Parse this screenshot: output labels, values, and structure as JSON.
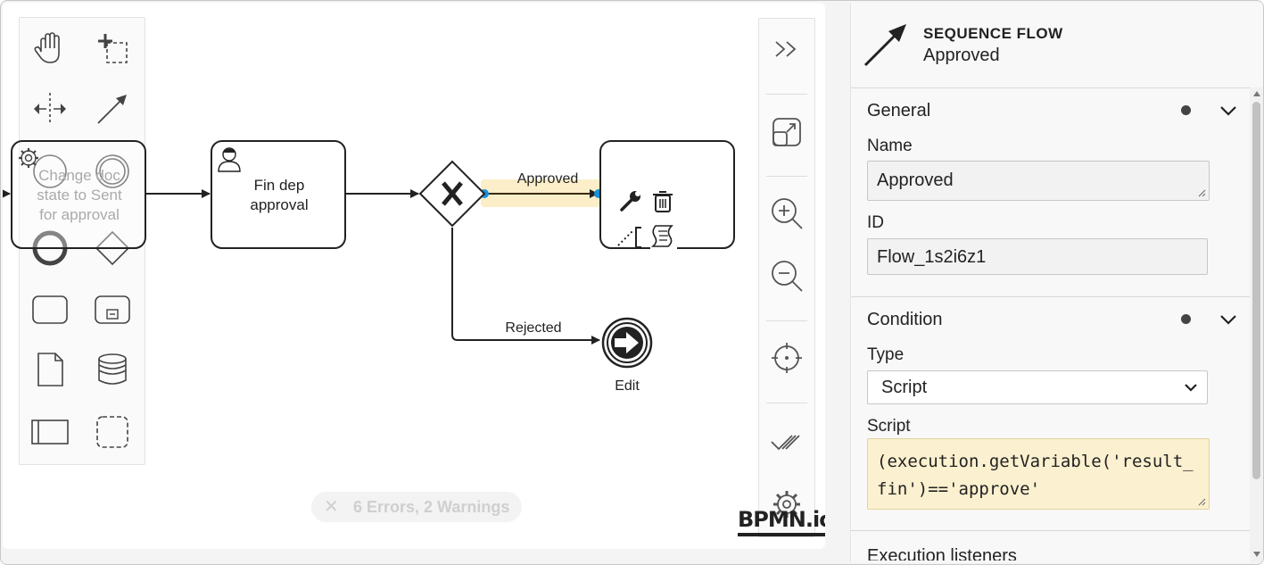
{
  "diagram": {
    "task_change_doc": "Change doc state to Sent for approval",
    "task_fin_dep_line1": "Fin dep",
    "task_fin_dep_line2": "approval",
    "flow_approved_label": "Approved",
    "flow_rejected_label": "Rejected",
    "end_event_label": "Edit",
    "task_change_doc_line1": "Change doc",
    "task_change_doc_line2": "state to Sent",
    "task_change_doc_line3": "for approval"
  },
  "palette": {
    "tools": [
      "hand-tool-icon",
      "lasso-tool-icon",
      "space-tool-icon",
      "global-connect-tool-icon",
      "start-event-icon",
      "intermediate-event-icon",
      "end-event-icon",
      "gateway-icon",
      "task-icon",
      "subprocess-icon",
      "data-object-icon",
      "data-store-icon",
      "pool-icon",
      "group-icon"
    ]
  },
  "status": {
    "errors": "6 Errors, 2 Warnings"
  },
  "brand": {
    "logo": "BPMN.io"
  },
  "panel": {
    "header_type": "SEQUENCE FLOW",
    "header_name": "Approved",
    "general": {
      "title": "General",
      "name_label": "Name",
      "name_value": "Approved",
      "id_label": "ID",
      "id_value": "Flow_1s2i6z1"
    },
    "condition": {
      "title": "Condition",
      "type_label": "Type",
      "type_value": "Script",
      "script_label": "Script",
      "script_value": "(execution.getVariable('result_fin')=='approve'"
    },
    "next_section_partial": "Execution listeners"
  },
  "colors": {
    "selection_highlight": "#fbeec8",
    "connection_point": "#1a8fd6",
    "script_bg": "#fbf0cf"
  }
}
